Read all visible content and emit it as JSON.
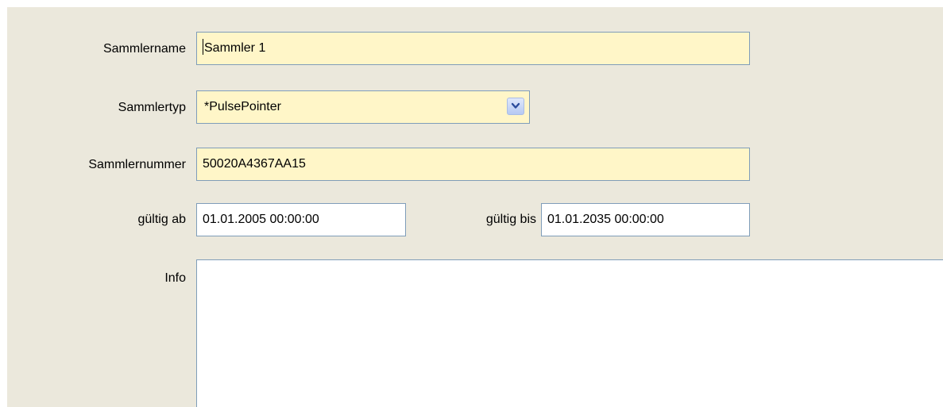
{
  "form": {
    "name_label": "Sammlername",
    "name_value": "Sammler 1",
    "type_label": "Sammlertyp",
    "type_value": "*PulsePointer",
    "number_label": "Sammlernummer",
    "number_value": "50020A4367AA15",
    "valid_from_label": "gültig ab",
    "valid_from_value": "01.01.2005 00:00:00",
    "valid_to_label": "gültig bis",
    "valid_to_value": "01.01.2035 00:00:00",
    "info_label": "Info",
    "info_value": ""
  },
  "colors": {
    "panel_bg": "#ebe8dc",
    "required_field_bg": "#fff6c8",
    "field_border": "#7f9db9"
  },
  "icons": {
    "dropdown": "chevron-down-icon"
  }
}
